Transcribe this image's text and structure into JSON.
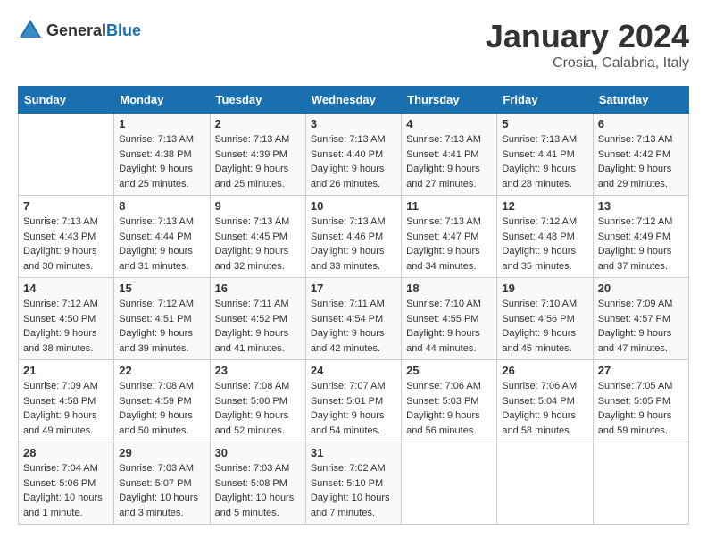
{
  "header": {
    "logo_general": "General",
    "logo_blue": "Blue",
    "month_year": "January 2024",
    "location": "Crosia, Calabria, Italy"
  },
  "columns": [
    "Sunday",
    "Monday",
    "Tuesday",
    "Wednesday",
    "Thursday",
    "Friday",
    "Saturday"
  ],
  "weeks": [
    [
      {
        "day": "",
        "sunrise": "",
        "sunset": "",
        "daylight": ""
      },
      {
        "day": "1",
        "sunrise": "Sunrise: 7:13 AM",
        "sunset": "Sunset: 4:38 PM",
        "daylight": "Daylight: 9 hours and 25 minutes."
      },
      {
        "day": "2",
        "sunrise": "Sunrise: 7:13 AM",
        "sunset": "Sunset: 4:39 PM",
        "daylight": "Daylight: 9 hours and 25 minutes."
      },
      {
        "day": "3",
        "sunrise": "Sunrise: 7:13 AM",
        "sunset": "Sunset: 4:40 PM",
        "daylight": "Daylight: 9 hours and 26 minutes."
      },
      {
        "day": "4",
        "sunrise": "Sunrise: 7:13 AM",
        "sunset": "Sunset: 4:41 PM",
        "daylight": "Daylight: 9 hours and 27 minutes."
      },
      {
        "day": "5",
        "sunrise": "Sunrise: 7:13 AM",
        "sunset": "Sunset: 4:41 PM",
        "daylight": "Daylight: 9 hours and 28 minutes."
      },
      {
        "day": "6",
        "sunrise": "Sunrise: 7:13 AM",
        "sunset": "Sunset: 4:42 PM",
        "daylight": "Daylight: 9 hours and 29 minutes."
      }
    ],
    [
      {
        "day": "7",
        "sunrise": "Sunrise: 7:13 AM",
        "sunset": "Sunset: 4:43 PM",
        "daylight": "Daylight: 9 hours and 30 minutes."
      },
      {
        "day": "8",
        "sunrise": "Sunrise: 7:13 AM",
        "sunset": "Sunset: 4:44 PM",
        "daylight": "Daylight: 9 hours and 31 minutes."
      },
      {
        "day": "9",
        "sunrise": "Sunrise: 7:13 AM",
        "sunset": "Sunset: 4:45 PM",
        "daylight": "Daylight: 9 hours and 32 minutes."
      },
      {
        "day": "10",
        "sunrise": "Sunrise: 7:13 AM",
        "sunset": "Sunset: 4:46 PM",
        "daylight": "Daylight: 9 hours and 33 minutes."
      },
      {
        "day": "11",
        "sunrise": "Sunrise: 7:13 AM",
        "sunset": "Sunset: 4:47 PM",
        "daylight": "Daylight: 9 hours and 34 minutes."
      },
      {
        "day": "12",
        "sunrise": "Sunrise: 7:12 AM",
        "sunset": "Sunset: 4:48 PM",
        "daylight": "Daylight: 9 hours and 35 minutes."
      },
      {
        "day": "13",
        "sunrise": "Sunrise: 7:12 AM",
        "sunset": "Sunset: 4:49 PM",
        "daylight": "Daylight: 9 hours and 37 minutes."
      }
    ],
    [
      {
        "day": "14",
        "sunrise": "Sunrise: 7:12 AM",
        "sunset": "Sunset: 4:50 PM",
        "daylight": "Daylight: 9 hours and 38 minutes."
      },
      {
        "day": "15",
        "sunrise": "Sunrise: 7:12 AM",
        "sunset": "Sunset: 4:51 PM",
        "daylight": "Daylight: 9 hours and 39 minutes."
      },
      {
        "day": "16",
        "sunrise": "Sunrise: 7:11 AM",
        "sunset": "Sunset: 4:52 PM",
        "daylight": "Daylight: 9 hours and 41 minutes."
      },
      {
        "day": "17",
        "sunrise": "Sunrise: 7:11 AM",
        "sunset": "Sunset: 4:54 PM",
        "daylight": "Daylight: 9 hours and 42 minutes."
      },
      {
        "day": "18",
        "sunrise": "Sunrise: 7:10 AM",
        "sunset": "Sunset: 4:55 PM",
        "daylight": "Daylight: 9 hours and 44 minutes."
      },
      {
        "day": "19",
        "sunrise": "Sunrise: 7:10 AM",
        "sunset": "Sunset: 4:56 PM",
        "daylight": "Daylight: 9 hours and 45 minutes."
      },
      {
        "day": "20",
        "sunrise": "Sunrise: 7:09 AM",
        "sunset": "Sunset: 4:57 PM",
        "daylight": "Daylight: 9 hours and 47 minutes."
      }
    ],
    [
      {
        "day": "21",
        "sunrise": "Sunrise: 7:09 AM",
        "sunset": "Sunset: 4:58 PM",
        "daylight": "Daylight: 9 hours and 49 minutes."
      },
      {
        "day": "22",
        "sunrise": "Sunrise: 7:08 AM",
        "sunset": "Sunset: 4:59 PM",
        "daylight": "Daylight: 9 hours and 50 minutes."
      },
      {
        "day": "23",
        "sunrise": "Sunrise: 7:08 AM",
        "sunset": "Sunset: 5:00 PM",
        "daylight": "Daylight: 9 hours and 52 minutes."
      },
      {
        "day": "24",
        "sunrise": "Sunrise: 7:07 AM",
        "sunset": "Sunset: 5:01 PM",
        "daylight": "Daylight: 9 hours and 54 minutes."
      },
      {
        "day": "25",
        "sunrise": "Sunrise: 7:06 AM",
        "sunset": "Sunset: 5:03 PM",
        "daylight": "Daylight: 9 hours and 56 minutes."
      },
      {
        "day": "26",
        "sunrise": "Sunrise: 7:06 AM",
        "sunset": "Sunset: 5:04 PM",
        "daylight": "Daylight: 9 hours and 58 minutes."
      },
      {
        "day": "27",
        "sunrise": "Sunrise: 7:05 AM",
        "sunset": "Sunset: 5:05 PM",
        "daylight": "Daylight: 9 hours and 59 minutes."
      }
    ],
    [
      {
        "day": "28",
        "sunrise": "Sunrise: 7:04 AM",
        "sunset": "Sunset: 5:06 PM",
        "daylight": "Daylight: 10 hours and 1 minute."
      },
      {
        "day": "29",
        "sunrise": "Sunrise: 7:03 AM",
        "sunset": "Sunset: 5:07 PM",
        "daylight": "Daylight: 10 hours and 3 minutes."
      },
      {
        "day": "30",
        "sunrise": "Sunrise: 7:03 AM",
        "sunset": "Sunset: 5:08 PM",
        "daylight": "Daylight: 10 hours and 5 minutes."
      },
      {
        "day": "31",
        "sunrise": "Sunrise: 7:02 AM",
        "sunset": "Sunset: 5:10 PM",
        "daylight": "Daylight: 10 hours and 7 minutes."
      },
      {
        "day": "",
        "sunrise": "",
        "sunset": "",
        "daylight": ""
      },
      {
        "day": "",
        "sunrise": "",
        "sunset": "",
        "daylight": ""
      },
      {
        "day": "",
        "sunrise": "",
        "sunset": "",
        "daylight": ""
      }
    ]
  ]
}
